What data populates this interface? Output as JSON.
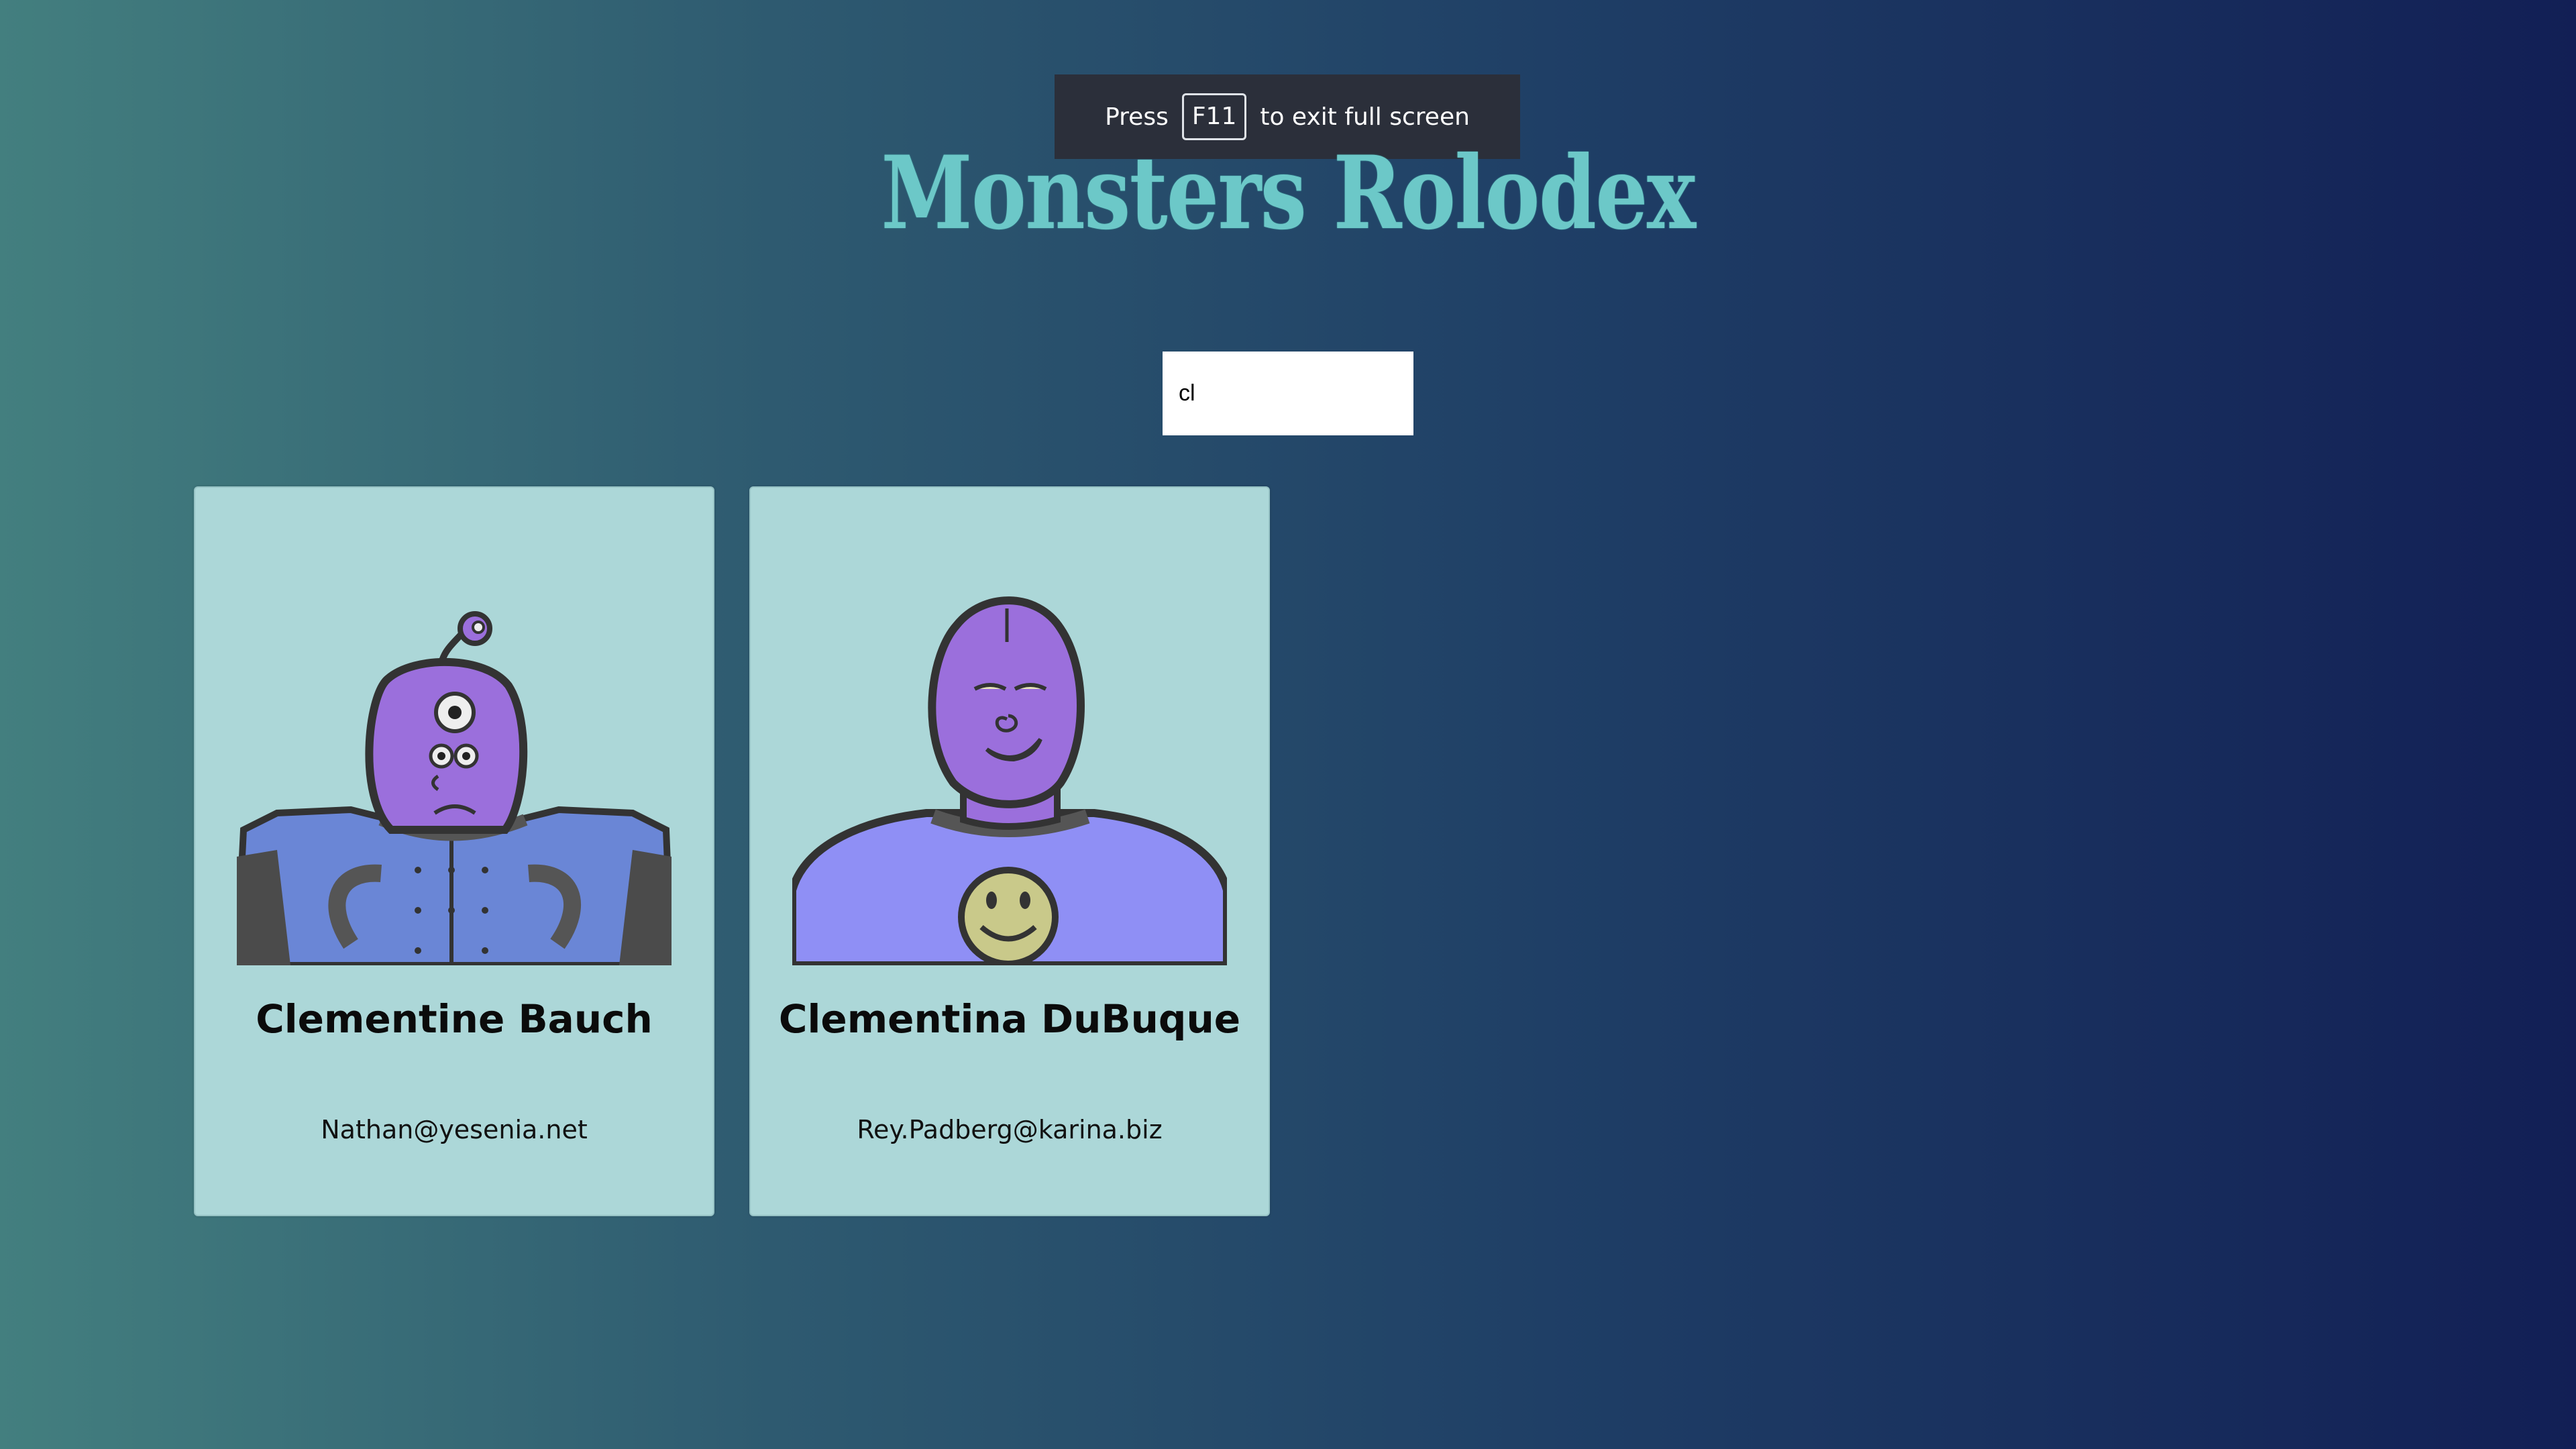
{
  "fullscreen_notice": {
    "prefix": "Press",
    "key": "F11",
    "suffix": "to exit full screen"
  },
  "app": {
    "title": "Monsters Rolodex"
  },
  "search": {
    "value": "cl",
    "placeholder": ""
  },
  "monsters": [
    {
      "name": "Clementine Bauch",
      "email": "Nathan@yesenia.net",
      "avatar_icon": "robot-monster-avatar"
    },
    {
      "name": "Clementina DuBuque",
      "email": "Rey.Padberg@karina.biz",
      "avatar_icon": "smiley-monster-avatar"
    }
  ],
  "colors": {
    "title": "#6cc8c8",
    "card_bg": "#acd7d8",
    "monster_skin": "#9b6fdc",
    "banner_bg": "#2b2f3a"
  }
}
